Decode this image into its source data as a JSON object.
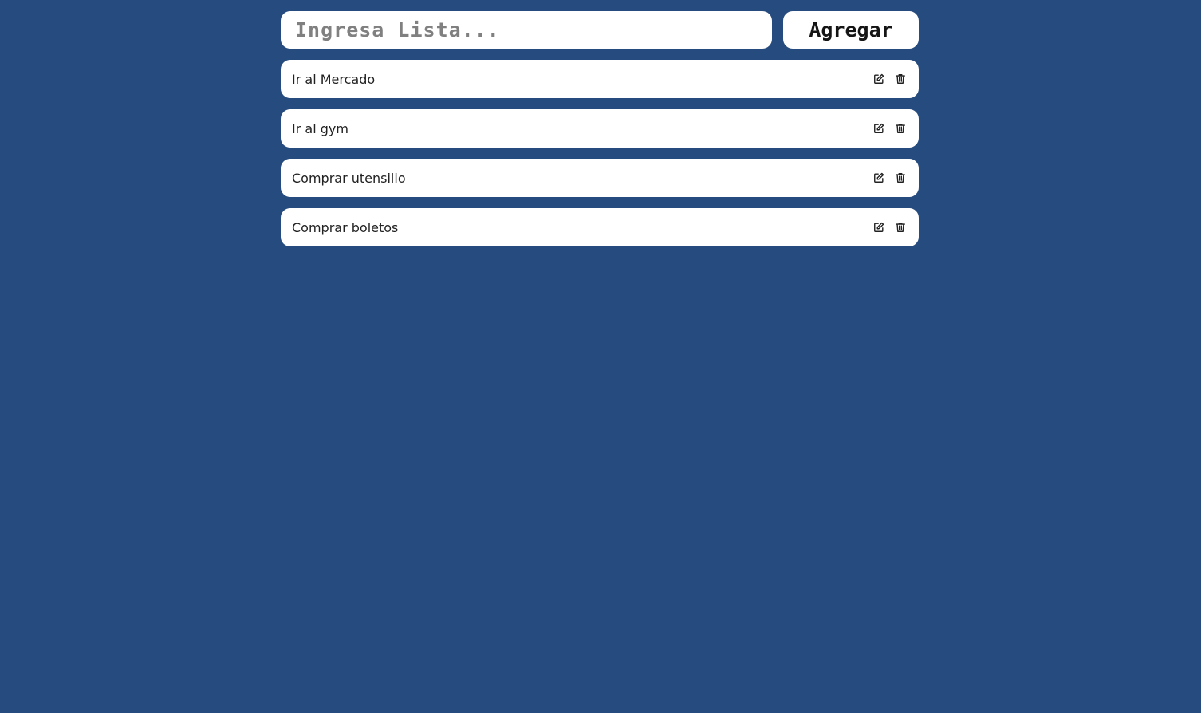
{
  "form": {
    "input_placeholder": "Ingresa Lista...",
    "input_value": "",
    "add_button_label": "Agregar"
  },
  "tasks": [
    {
      "text": "Ir al Mercado",
      "edit_icon": "edit-icon",
      "delete_icon": "trash-icon"
    },
    {
      "text": "Ir al gym",
      "edit_icon": "edit-icon",
      "delete_icon": "trash-icon"
    },
    {
      "text": "Comprar utensilio",
      "edit_icon": "edit-icon",
      "delete_icon": "trash-icon"
    },
    {
      "text": "Comprar boletos",
      "edit_icon": "edit-icon",
      "delete_icon": "trash-icon"
    }
  ],
  "colors": {
    "background": "#264b7e",
    "card": "#ffffff",
    "text": "#222222",
    "placeholder": "#808080"
  }
}
